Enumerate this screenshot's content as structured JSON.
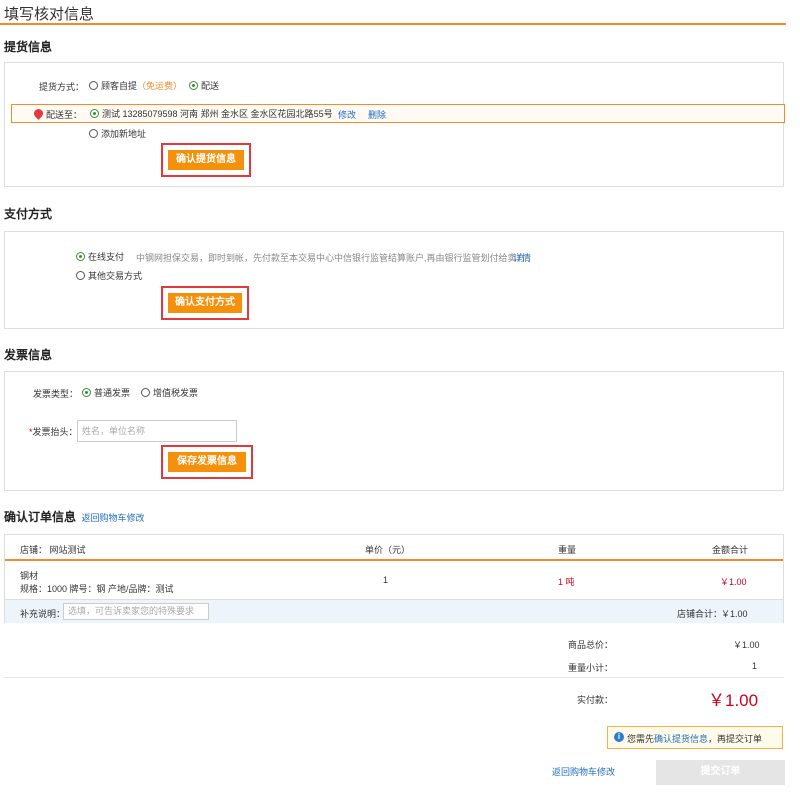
{
  "page": {
    "title": "填写核对信息"
  },
  "delivery": {
    "title": "提货信息",
    "method_label": "提货方式：",
    "self_pickup": "顾客自提",
    "free_note": "（免运费）",
    "ship": "配送",
    "ship_to_label": "配送至：",
    "address": "测试 13285079598 河南 郑州 金水区 金水区花园北路55号",
    "edit": "修改",
    "delete": "删除",
    "add_new": "添加新地址",
    "confirm_btn": "确认提货信息"
  },
  "payment": {
    "title": "支付方式",
    "online": "在线支付",
    "online_desc": "中钢网担保交易，即时到帐，先付款至本交易中心中信银行监管结算账户,再由银行监管划付给卖方",
    "detail_link": "详情",
    "other": "其他交易方式",
    "confirm_btn": "确认支付方式"
  },
  "invoice": {
    "title": "发票信息",
    "type_label": "发票类型：",
    "normal": "普通发票",
    "vat": "增值税发票",
    "required_mark": "*",
    "header_label": "发票抬头：",
    "header_placeholder": "姓名，单位名称",
    "save_btn": "保存发票信息"
  },
  "order": {
    "title": "确认订单信息",
    "back_link": "返回购物车修改",
    "columns": {
      "shop": "店铺： 网站测试",
      "price": "单价（元）",
      "weight": "重量",
      "total": "金额合计"
    },
    "item": {
      "name": "钢材",
      "spec": "规格：1000 牌号：钢 产地/品牌：测试",
      "price": "1",
      "weight": "1 吨",
      "total": "￥1.00"
    },
    "note_label": "补充说明：",
    "note_placeholder": "选填，可告诉卖家您的特殊要求",
    "shop_total_label": "店铺合计：",
    "shop_total": "￥1.00"
  },
  "summary": {
    "goods_total_label": "商品总价：",
    "goods_total": "￥1.00",
    "weight_subtotal_label": "重量小计：",
    "weight_subtotal": "1",
    "pay_label": "实付款：",
    "pay_amount": "￥1.00"
  },
  "notice": {
    "prefix": "您需先",
    "link": "确认提货信息",
    "suffix": "，再提交订单"
  },
  "footer": {
    "back_link": "返回购物车修改",
    "submit": "提交订单"
  },
  "colors": {
    "accent": "#f08c2e",
    "button": "#f5900a",
    "price_red": "#d0021b",
    "link": "#1f6bbf"
  }
}
